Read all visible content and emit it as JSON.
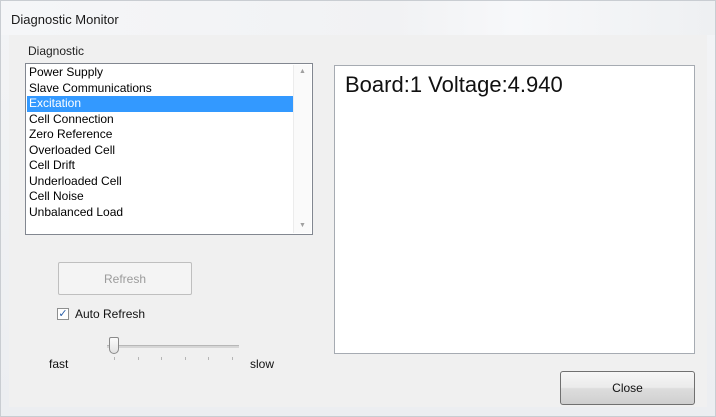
{
  "window": {
    "title": "Diagnostic Monitor"
  },
  "diagnostic": {
    "group_label": "Diagnostic",
    "items": [
      {
        "label": "Power Supply",
        "selected": false
      },
      {
        "label": "Slave Communications",
        "selected": false
      },
      {
        "label": "Excitation",
        "selected": true
      },
      {
        "label": "Cell Connection",
        "selected": false
      },
      {
        "label": "Zero Reference",
        "selected": false
      },
      {
        "label": "Overloaded Cell",
        "selected": false
      },
      {
        "label": "Cell Drift",
        "selected": false
      },
      {
        "label": "Underloaded Cell",
        "selected": false
      },
      {
        "label": "Cell Noise",
        "selected": false
      },
      {
        "label": "Unbalanced Load",
        "selected": false
      }
    ]
  },
  "output": {
    "text": "Board:1 Voltage:4.940"
  },
  "controls": {
    "refresh_label": "Refresh",
    "auto_refresh_label": "Auto Refresh",
    "auto_refresh_checked": true,
    "check_glyph": "✓",
    "speed_min_label": "fast",
    "speed_max_label": "slow",
    "speed_value": 0,
    "speed_ticks": 6
  },
  "footer": {
    "close_label": "Close"
  },
  "colors": {
    "selection": "#3399ff"
  }
}
